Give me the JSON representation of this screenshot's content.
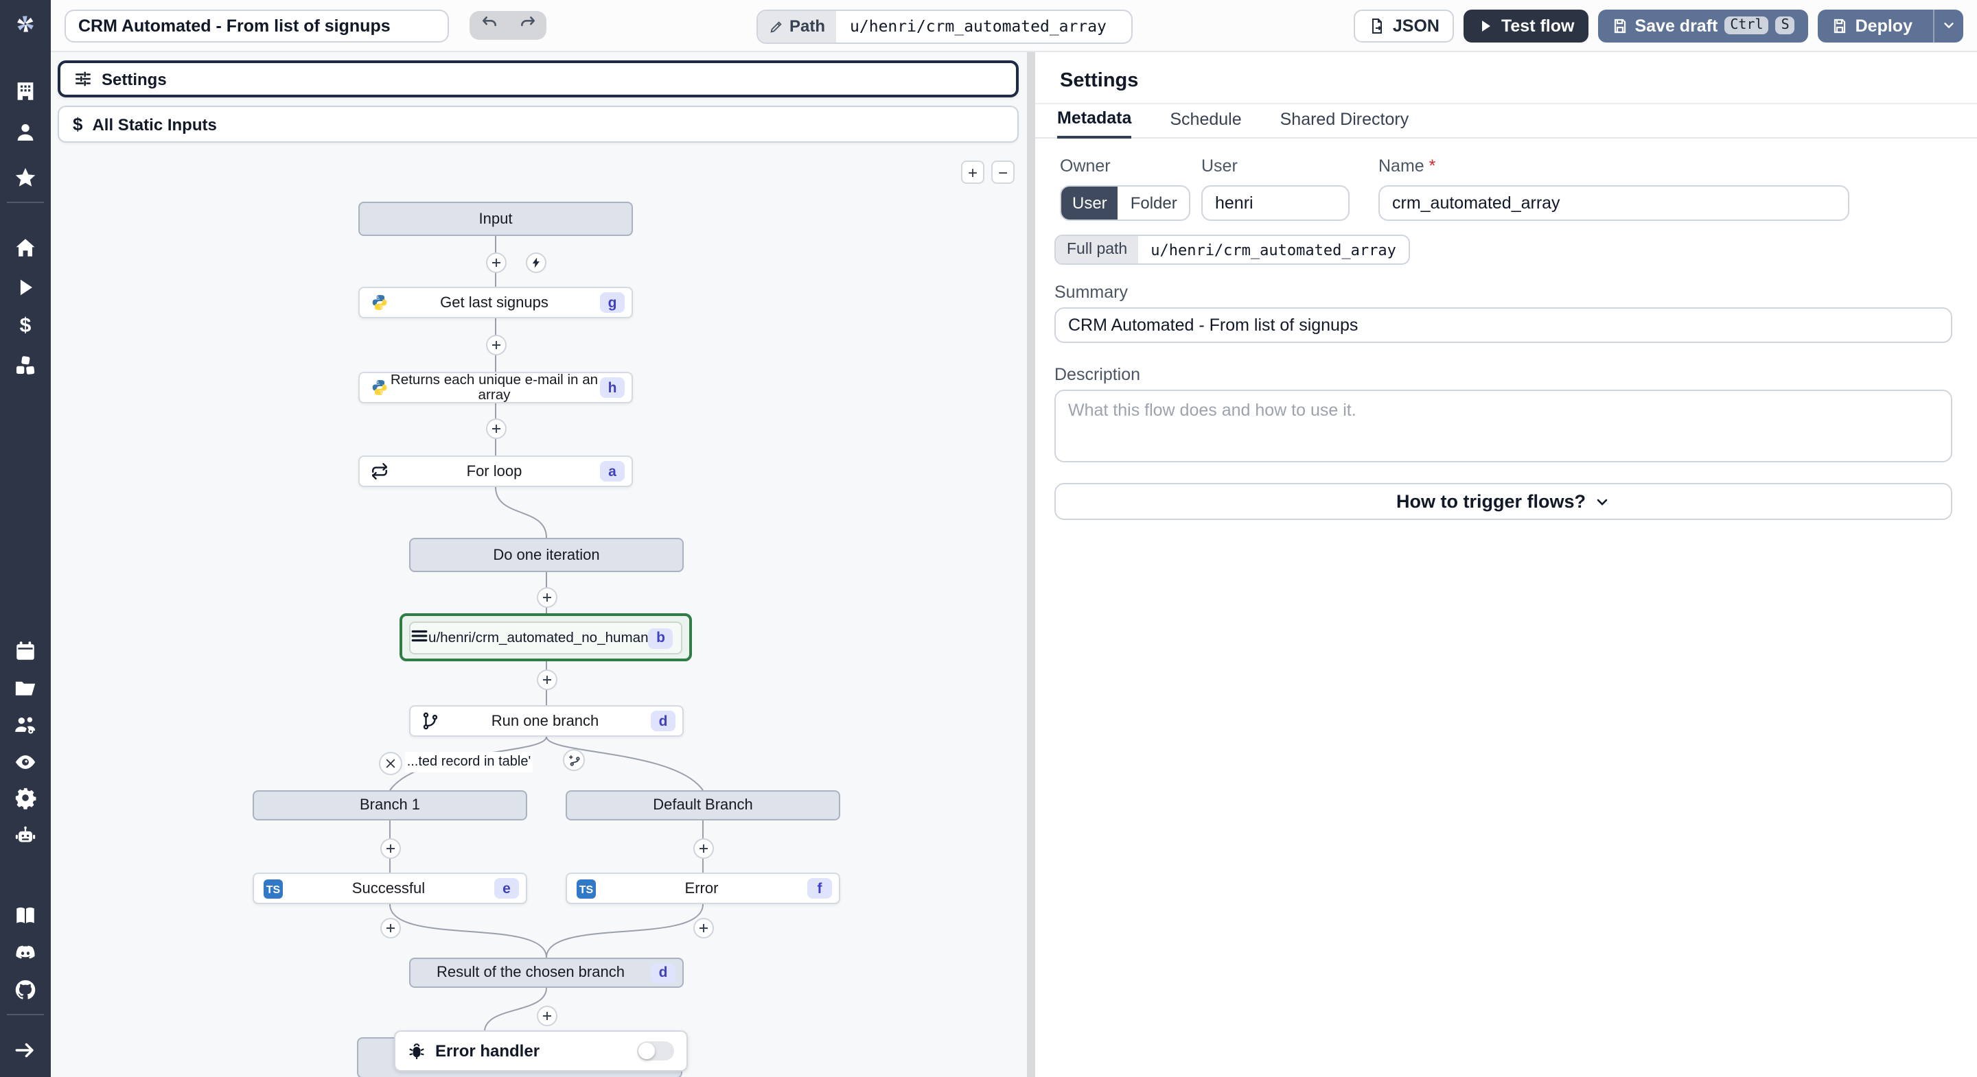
{
  "topbar": {
    "title": "CRM Automated - From list of signups",
    "path_label": "Path",
    "path_value": "u/henri/crm_automated_array",
    "json_label": "JSON",
    "test_flow_label": "Test flow",
    "save_draft_label": "Save draft",
    "kbd_ctrl": "Ctrl",
    "kbd_s": "S",
    "deploy_label": "Deploy"
  },
  "flow": {
    "settings_bar_label": "Settings",
    "static_inputs_label": "All Static Inputs",
    "zoom_in": "+",
    "zoom_out": "−",
    "dollar_glyph": "$",
    "ts_glyph": "TS",
    "nodes": {
      "input": {
        "label": "Input"
      },
      "get_last": {
        "label": "Get last signups",
        "badge": "g"
      },
      "unique_emails": {
        "label": "Returns each unique e-mail in an array",
        "badge": "h"
      },
      "for_loop": {
        "label": "For loop",
        "badge": "a"
      },
      "do_one_iteration": {
        "label": "Do one iteration"
      },
      "crm_step": {
        "label": "u/henri/crm_automated_no_human",
        "badge": "b"
      },
      "run_one_branch": {
        "label": "Run one branch",
        "badge": "d"
      },
      "condition": {
        "label": "...ted record in table'"
      },
      "branch_1": {
        "label": "Branch 1"
      },
      "default_branch": {
        "label": "Default Branch"
      },
      "successful": {
        "label": "Successful",
        "badge": "e"
      },
      "error": {
        "label": "Error",
        "badge": "f"
      },
      "result": {
        "label": "Result of the chosen branch",
        "badge": "d"
      },
      "error_handler": {
        "label": "Error handler"
      }
    }
  },
  "panel": {
    "heading": "Settings",
    "tabs": [
      "Metadata",
      "Schedule",
      "Shared Directory"
    ],
    "owner_label": "Owner",
    "owner_user": "User",
    "owner_folder": "Folder",
    "user_label": "User",
    "user_value": "henri",
    "name_label": "Name",
    "required_mark": "*",
    "name_value": "crm_automated_array",
    "full_path_label": "Full path",
    "full_path_value": "u/henri/crm_automated_array",
    "summary_label": "Summary",
    "summary_value": "CRM Automated - From list of signups",
    "description_label": "Description",
    "description_placeholder": "What this flow does and how to use it.",
    "trigger_button_label": "How to trigger flows?"
  },
  "colors": {
    "accent_slate_button": "#5e7296",
    "selected_node_green": "#2f7d44",
    "badge_bg": "#dfe3fb",
    "sidebar_bg": "#2e3546"
  }
}
